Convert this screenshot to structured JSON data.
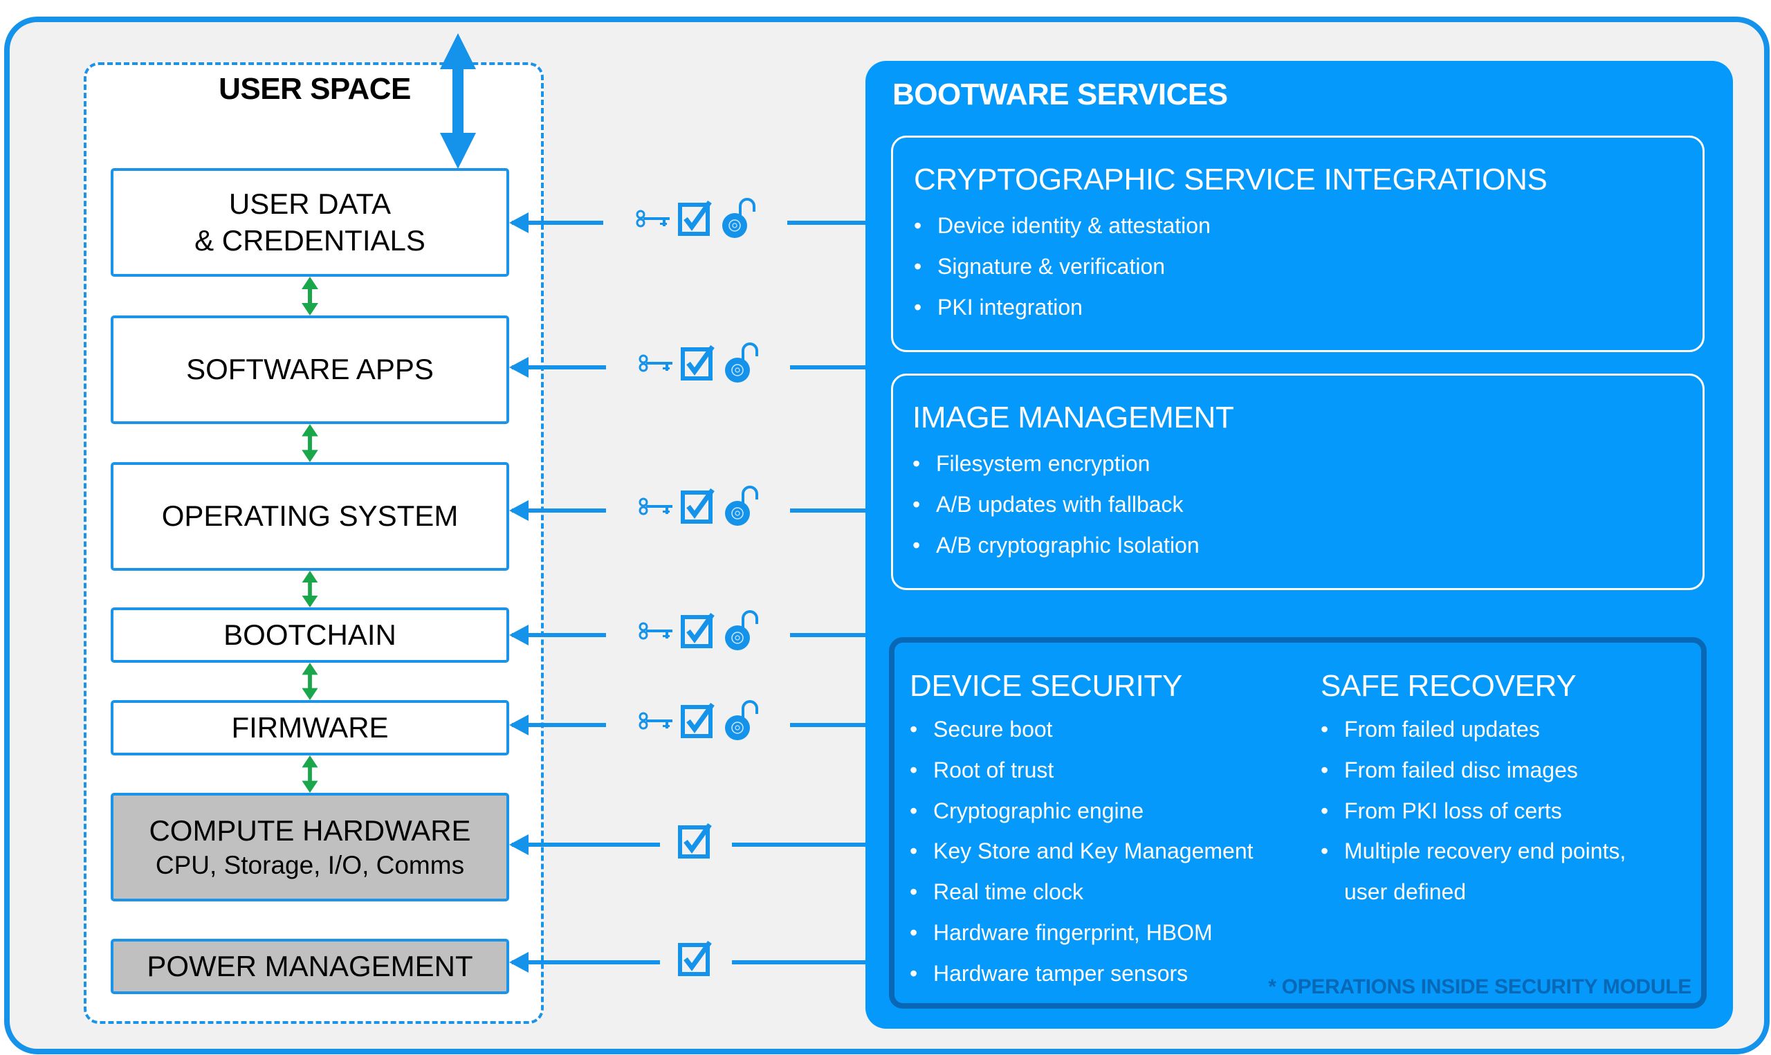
{
  "user_space": {
    "title": "USER SPACE",
    "layers": [
      {
        "line1": "USER DATA",
        "line2": "& CREDENTIALS",
        "type": "software",
        "icons": [
          "key-icon",
          "checkbox-icon",
          "padlock-icon"
        ]
      },
      {
        "line1": "SOFTWARE APPS",
        "type": "software",
        "icons": [
          "key-icon",
          "checkbox-icon",
          "padlock-icon"
        ]
      },
      {
        "line1": "OPERATING SYSTEM",
        "type": "software",
        "icons": [
          "key-icon",
          "checkbox-icon",
          "padlock-icon"
        ]
      },
      {
        "line1": "BOOTCHAIN",
        "type": "software",
        "icons": [
          "key-icon",
          "checkbox-icon",
          "padlock-icon"
        ]
      },
      {
        "line1": "FIRMWARE",
        "type": "software",
        "icons": [
          "key-icon",
          "checkbox-icon",
          "padlock-icon"
        ]
      },
      {
        "line1": "COMPUTE HARDWARE",
        "line2": "CPU, Storage, I/O, Comms",
        "type": "hardware",
        "icons": [
          "checkbox-icon"
        ]
      },
      {
        "line1": "POWER MANAGEMENT",
        "type": "hardware",
        "icons": [
          "checkbox-icon"
        ]
      }
    ]
  },
  "bootware": {
    "title": "BOOTWARE SERVICES",
    "crypto": {
      "title": "CRYPTOGRAPHIC SERVICE INTEGRATIONS",
      "items": [
        "Device identity & attestation",
        "Signature & verification",
        "PKI integration"
      ]
    },
    "image_management": {
      "title": "IMAGE MANAGEMENT",
      "items": [
        "Filesystem encryption",
        "A/B updates with fallback",
        "A/B cryptographic Isolation"
      ]
    },
    "device_security": {
      "title": "DEVICE SECURITY",
      "items": [
        "Secure boot",
        "Root of trust",
        "Cryptographic engine",
        "Key Store and Key Management",
        "Real time clock",
        "Hardware fingerprint, HBOM",
        "Hardware tamper sensors"
      ]
    },
    "safe_recovery": {
      "title": "SAFE RECOVERY",
      "items": [
        "From failed updates",
        "From failed disc images",
        "From PKI loss of certs",
        "Multiple recovery end points,",
        "user defined"
      ]
    },
    "footnote": "* OPERATIONS INSIDE SECURITY MODULE"
  },
  "bullet": "•",
  "colors": {
    "accent_blue": "#1592ea",
    "panel_blue": "#0499fb",
    "dark_blue": "#0868b6",
    "green_arrow": "#1aa64a",
    "hardware_gray": "#c0c0c0",
    "background": "#f1f1f1"
  }
}
